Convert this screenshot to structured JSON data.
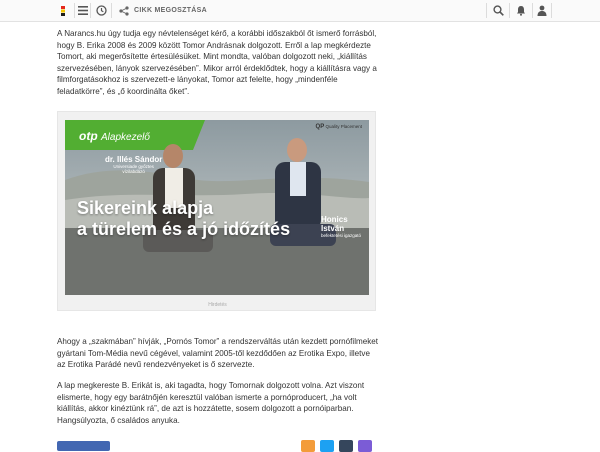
{
  "topbar": {
    "share_label": "CIKK MEGOSZTÁSA"
  },
  "article": {
    "paragraph1": "A Narancs.hu úgy tudja egy névtelenséget kérő, a korábbi időszakból őt ismerő forrásból, hogy B. Erika 2008 és 2009 között Tomor Andrásnak dolgozott. Erről a lap megkérdezte Tomort, aki megerősítette értesülésüket. Mint mondta, valóban dolgozott neki, „kiállítás szervezésében, lányok szervezésében”. Mikor arról érdeklődtek, hogy a kiállításra vagy a filmforgatásokhoz is szervezett-e lányokat, Tomor azt felelte, hogy „mindenféle feladatkörre”, és „ő koordinálta őket”.",
    "paragraph2": "Ahogy a „szakmában” hívják, „Pornós Tomor” a rendszerváltás után kezdett pornófilmeket gyártani Tom-Média nevű cégével, valamint 2005-től kezdődően az Erotika Expo, illetve az Erotika Parádé nevű rendezvényeket is ő szervezte.",
    "paragraph3": "A lap megkereste B. Erikát is, aki tagadta, hogy Tomornak dolgozott volna. Azt viszont elismerte, hogy egy barátnőjén keresztül valóban ismerte a pornóproducert, „ha volt kiállítás, akkor kinéztünk rá”, de azt is hozzátette, sosem dolgozott a pornóiparban. Hangsúlyozta, ő családos anyuka."
  },
  "ad": {
    "logo_brand": "otp",
    "logo_sub": "Alapkezelő",
    "qp_abbr": "QP",
    "qp_text": "Quality Placement",
    "person1_name": "dr. Illés Sándor",
    "person1_title1": "Universiade győztes",
    "person1_title2": "vízilabdázó",
    "person2_name": "Honics István",
    "person2_title": "befektetési igazgató",
    "headline1": "Sikereink alapja",
    "headline2": "a türelem és a jó időzítés",
    "caption": "Hirdetés"
  },
  "colors": {
    "otp_green": "#52ae32",
    "facebook_blue": "#4267b2",
    "twitter_blue": "#1da1f2",
    "tumblr_navy": "#35465c",
    "messenger_purple": "#7b5cd6",
    "email_orange": "#f39c3a"
  },
  "icons": [
    "index-logo-icon",
    "menu-icon",
    "clock-icon",
    "share-icon",
    "search-icon",
    "bell-icon",
    "user-icon"
  ]
}
